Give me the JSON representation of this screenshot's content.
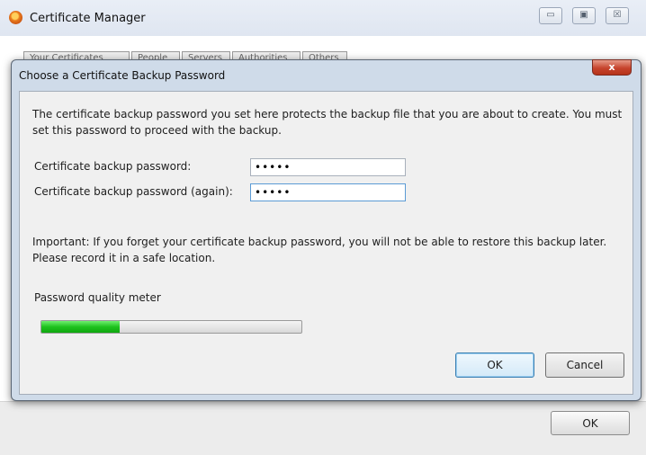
{
  "background_window": {
    "title": "Certificate Manager",
    "window_controls": {
      "minimize": "▭",
      "maximize": "▣",
      "close": "☒"
    },
    "tabs": [
      "Your Certificates",
      "People",
      "Servers",
      "Authorities",
      "Others"
    ],
    "ok_label": "OK"
  },
  "dialog": {
    "title": "Choose a Certificate Backup Password",
    "close_glyph": "x",
    "intro": "The certificate backup password you set here protects the backup file that you are about to create. You must set this password to proceed with the backup.",
    "fields": [
      {
        "label": "Certificate backup password:",
        "value": "•••••"
      },
      {
        "label": "Certificate backup password (again):",
        "value": "•••••"
      }
    ],
    "note": "Important: If you forget your certificate backup password, you will not be able to restore this backup later. Please record it in a safe location.",
    "meter": {
      "label": "Password quality meter",
      "quality_percent": 30
    },
    "ok_label": "OK",
    "cancel_label": "Cancel"
  },
  "colors": {
    "meter_fill": "#1ec21e",
    "close_button": "#c6432d",
    "dialog_frame": "#cfdbe9"
  }
}
